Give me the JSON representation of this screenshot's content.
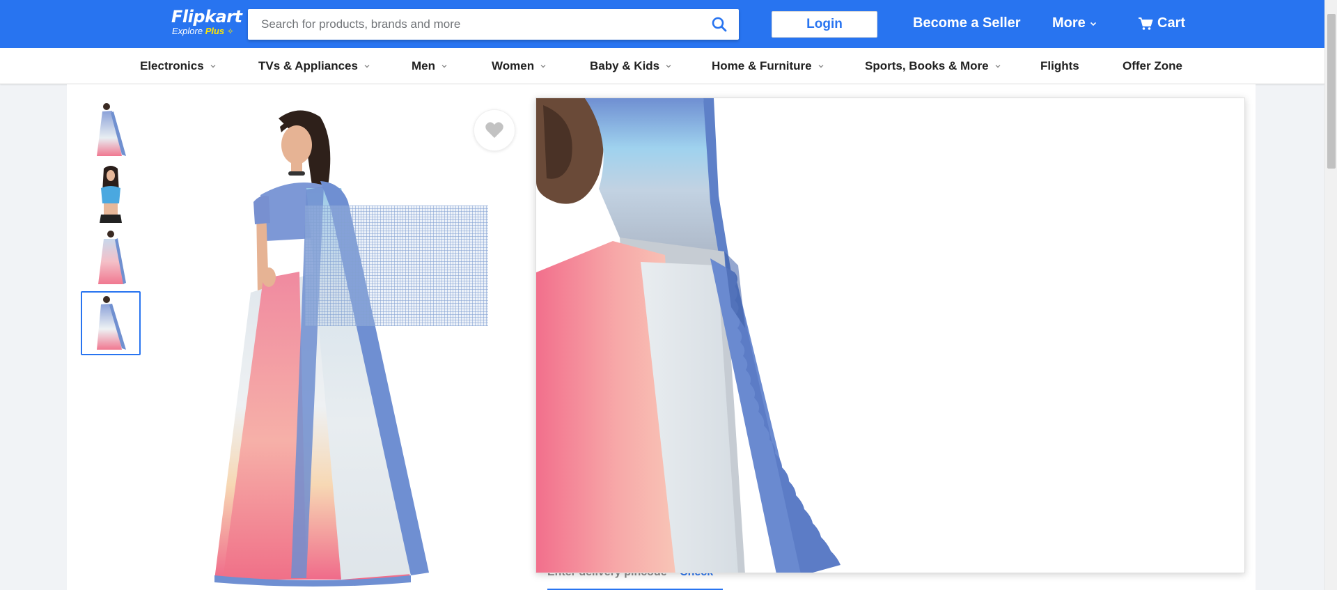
{
  "header": {
    "logo_text": "Flipkart",
    "logo_sub_explore": "Explore",
    "logo_sub_plus": "Plus",
    "search_placeholder": "Search for products, brands and more",
    "login_label": "Login",
    "seller_label": "Become a Seller",
    "more_label": "More",
    "cart_label": "Cart",
    "brand_color": "#2874f0",
    "accent_color": "#ffe500"
  },
  "nav": {
    "items": [
      {
        "label": "Electronics",
        "has_dropdown": true
      },
      {
        "label": "TVs & Appliances",
        "has_dropdown": true
      },
      {
        "label": "Men",
        "has_dropdown": true
      },
      {
        "label": "Women",
        "has_dropdown": true
      },
      {
        "label": "Baby & Kids",
        "has_dropdown": true
      },
      {
        "label": "Home & Furniture",
        "has_dropdown": true
      },
      {
        "label": "Sports, Books & More",
        "has_dropdown": true
      },
      {
        "label": "Flights",
        "has_dropdown": false
      },
      {
        "label": "Offer Zone",
        "has_dropdown": false
      }
    ]
  },
  "product": {
    "thumbnail_count": 4,
    "selected_thumbnail": 4,
    "wishlist_icon": "heart-icon",
    "delivery_prompt": "Enter delivery pincode",
    "check_label": "Check"
  },
  "icons": {
    "search": "search-icon",
    "cart": "cart-icon",
    "chevron": "chevron-down-icon",
    "heart": "heart-icon"
  }
}
